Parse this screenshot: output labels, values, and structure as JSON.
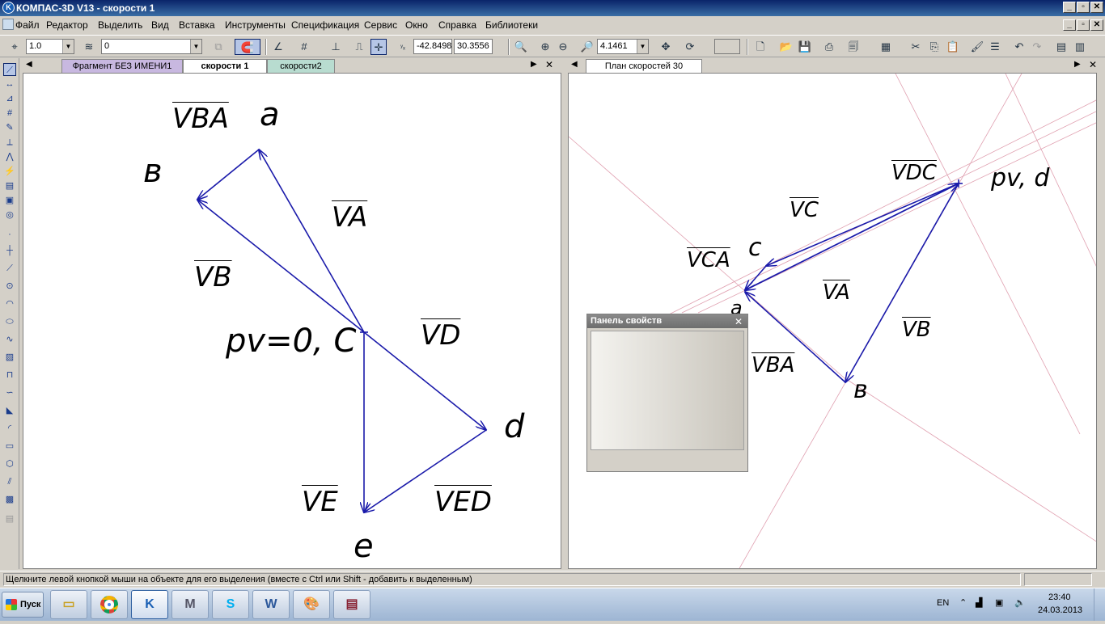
{
  "window": {
    "title": "КОМПАС-3D V13 - скорости 1"
  },
  "menu": [
    "Файл",
    "Редактор",
    "Выделить",
    "Вид",
    "Вставка",
    "Инструменты",
    "Спецификация",
    "Сервис",
    "Окно",
    "Справка",
    "Библиотеки"
  ],
  "toolbar": {
    "step_value": "1.0",
    "layer_value": "0",
    "coord_x": "-42.8498",
    "coord_y": "30.3556",
    "zoom_value": "4.1461"
  },
  "left_window": {
    "tabs": [
      "Фрагмент БЕЗ ИМЕНИ1",
      "скорости 1",
      "скорости2"
    ],
    "active_tab": "скорости 1",
    "labels": {
      "v_ba": "VBA",
      "a": "a",
      "b": "в",
      "v_a": "VA",
      "v_b": "VB",
      "pole": "pv=0, C",
      "v_d": "VD",
      "d": "d",
      "v_e": "VE",
      "v_ed": "VED",
      "e": "e"
    }
  },
  "right_window": {
    "tabs": [
      "План скоростей 30"
    ],
    "active_tab": "План скоростей 30",
    "labels": {
      "v_dc": "VDC",
      "pole": "pv, d",
      "v_c": "VC",
      "c": "c",
      "v_ca": "VCA",
      "v_a": "VA",
      "v_b": "VB",
      "v_ba": "VBA",
      "b": "в",
      "a": "a"
    }
  },
  "properties_panel": {
    "title": "Панель свойств"
  },
  "status": {
    "message": "Щелкните левой кнопкой мыши на объекте для его выделения (вместе с Ctrl или Shift - добавить к выделенным)"
  },
  "taskbar": {
    "start_label": "Пуск",
    "apps": [
      "folder-app",
      "chrome-app",
      "kompas-app",
      "mathcad-app",
      "skype-app",
      "word-app",
      "paint-app",
      "winrar-app"
    ],
    "lang": "EN",
    "time": "23:40",
    "date": "24.03.2013"
  },
  "colors": {
    "vector": "#1a1aaa",
    "construction": "#e0a0b0",
    "titlebar": "#0a246a"
  }
}
